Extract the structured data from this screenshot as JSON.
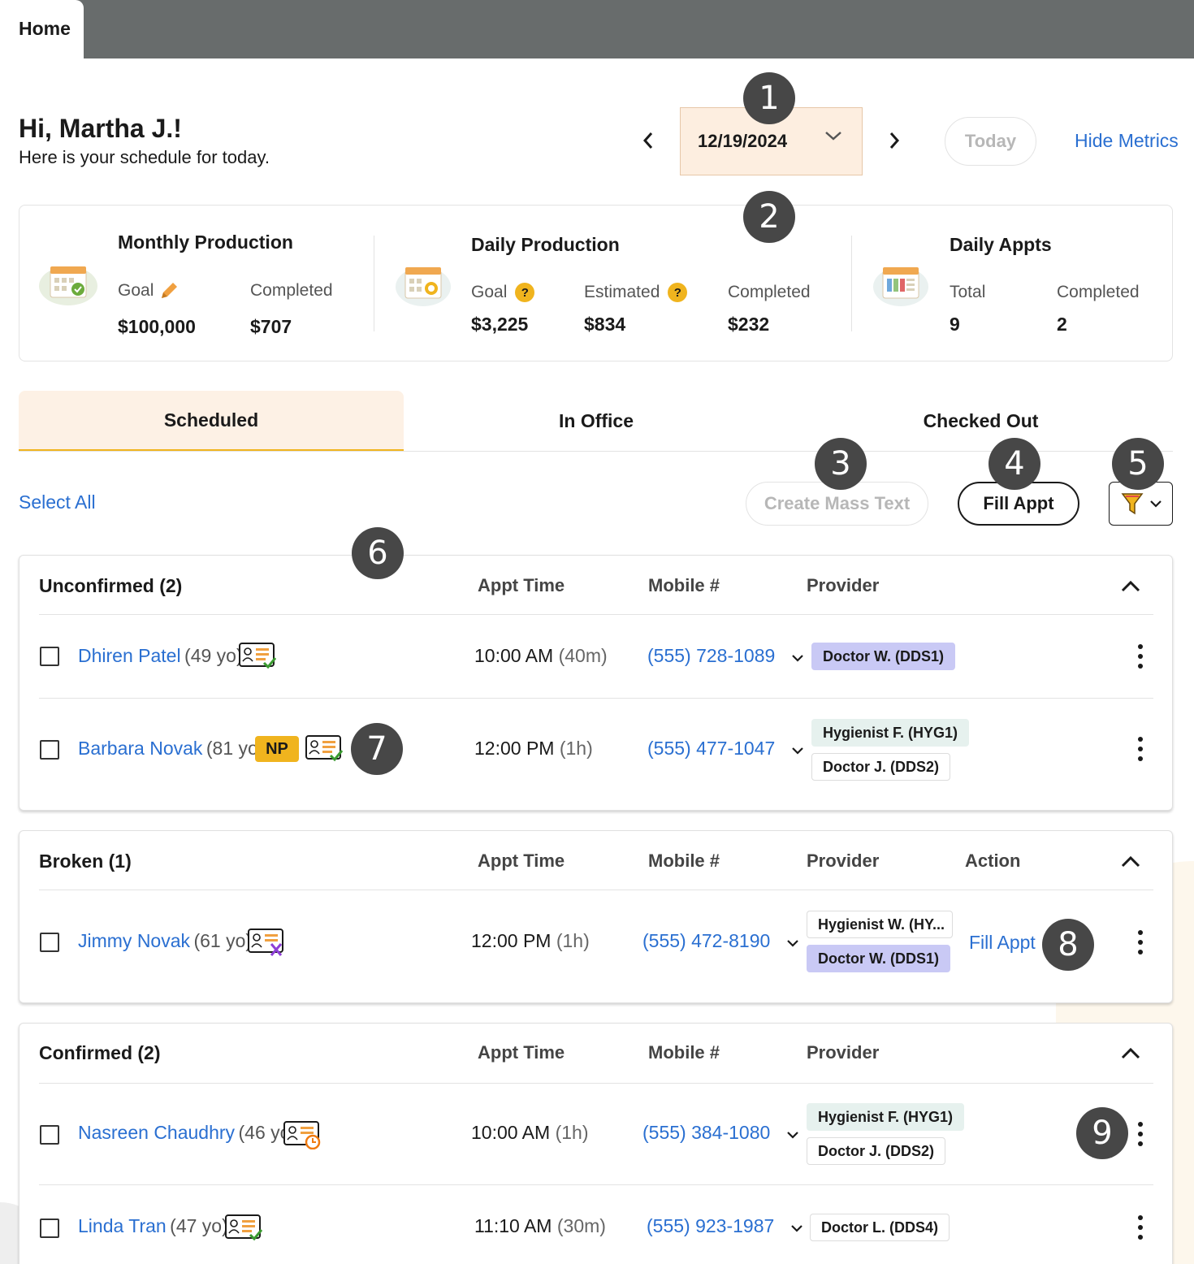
{
  "tab_home": "Home",
  "header": {
    "greeting": "Hi, Martha J.!",
    "subtitle": "Here is your schedule for today.",
    "date": "12/19/2024",
    "today_label": "Today",
    "hide_metrics": "Hide Metrics"
  },
  "metrics": {
    "monthly": {
      "title": "Monthly Production",
      "goal_label": "Goal",
      "goal_value": "$100,000",
      "completed_label": "Completed",
      "completed_value": "$707"
    },
    "daily": {
      "title": "Daily Production",
      "goal_label": "Goal",
      "goal_value": "$3,225",
      "estimated_label": "Estimated",
      "estimated_value": "$834",
      "completed_label": "Completed",
      "completed_value": "$232"
    },
    "appts": {
      "title": "Daily Appts",
      "total_label": "Total",
      "total_value": "9",
      "completed_label": "Completed",
      "completed_value": "2"
    }
  },
  "tabs": [
    "Scheduled",
    "In Office",
    "Checked Out"
  ],
  "toolbar": {
    "select_all": "Select All",
    "mass_text": "Create Mass Text",
    "fill_appt": "Fill Appt"
  },
  "columns": {
    "appt_time": "Appt Time",
    "mobile": "Mobile #",
    "provider": "Provider",
    "action": "Action"
  },
  "groups": {
    "unconfirmed": {
      "title": "Unconfirmed (2)",
      "rows": [
        {
          "name": "Dhiren Patel",
          "age": "(49 yo)",
          "time": "10:00 AM",
          "dur": "(40m)",
          "phone": "(555) 728-1089",
          "providers": [
            "Doctor W. (DDS1)"
          ]
        },
        {
          "name": "Barbara Novak",
          "age": "(81 yo)",
          "np": "NP",
          "time": "12:00 PM",
          "dur": "(1h)",
          "phone": "(555) 477-1047",
          "providers": [
            "Hygienist F. (HYG1)",
            "Doctor J. (DDS2)"
          ]
        }
      ]
    },
    "broken": {
      "title": "Broken (1)",
      "rows": [
        {
          "name": "Jimmy Novak",
          "age": "(61 yo)",
          "time": "12:00 PM",
          "dur": "(1h)",
          "phone": "(555) 472-8190",
          "providers": [
            "Hygienist W. (HY...",
            "Doctor W. (DDS1)"
          ],
          "action": "Fill Appt"
        }
      ]
    },
    "confirmed": {
      "title": "Confirmed (2)",
      "rows": [
        {
          "name": "Nasreen Chaudhry",
          "age": "(46 yo)",
          "time": "10:00 AM",
          "dur": "(1h)",
          "phone": "(555) 384-1080",
          "providers": [
            "Hygienist F. (HYG1)",
            "Doctor J. (DDS2)"
          ]
        },
        {
          "name": "Linda Tran",
          "age": "(47 yo)",
          "time": "11:10 AM",
          "dur": "(30m)",
          "phone": "(555) 923-1987",
          "providers": [
            "Doctor L. (DDS4)"
          ]
        }
      ]
    }
  },
  "callouts": [
    "1",
    "2",
    "3",
    "4",
    "5",
    "6",
    "7",
    "8",
    "9"
  ],
  "colors": {
    "accent": "#f0b41e",
    "link": "#2a6fd1",
    "date_bg": "#fdeee0",
    "topbar": "#686c6c",
    "chip_purple": "#c9c9f5",
    "chip_teal": "#e6f1ee",
    "callout": "#474747"
  },
  "icons": {
    "prev": "chevron-left-icon",
    "next": "chevron-right-icon",
    "dropdown": "chevron-down-icon",
    "edit": "pencil-icon",
    "help": "question-icon",
    "filter": "funnel-icon",
    "collapse": "chevron-up-icon",
    "more": "kebab-icon",
    "patient_card_ok": "patient-card-check-icon",
    "patient_card_broken": "patient-card-x-icon",
    "patient_card_pending": "patient-card-clock-icon"
  }
}
